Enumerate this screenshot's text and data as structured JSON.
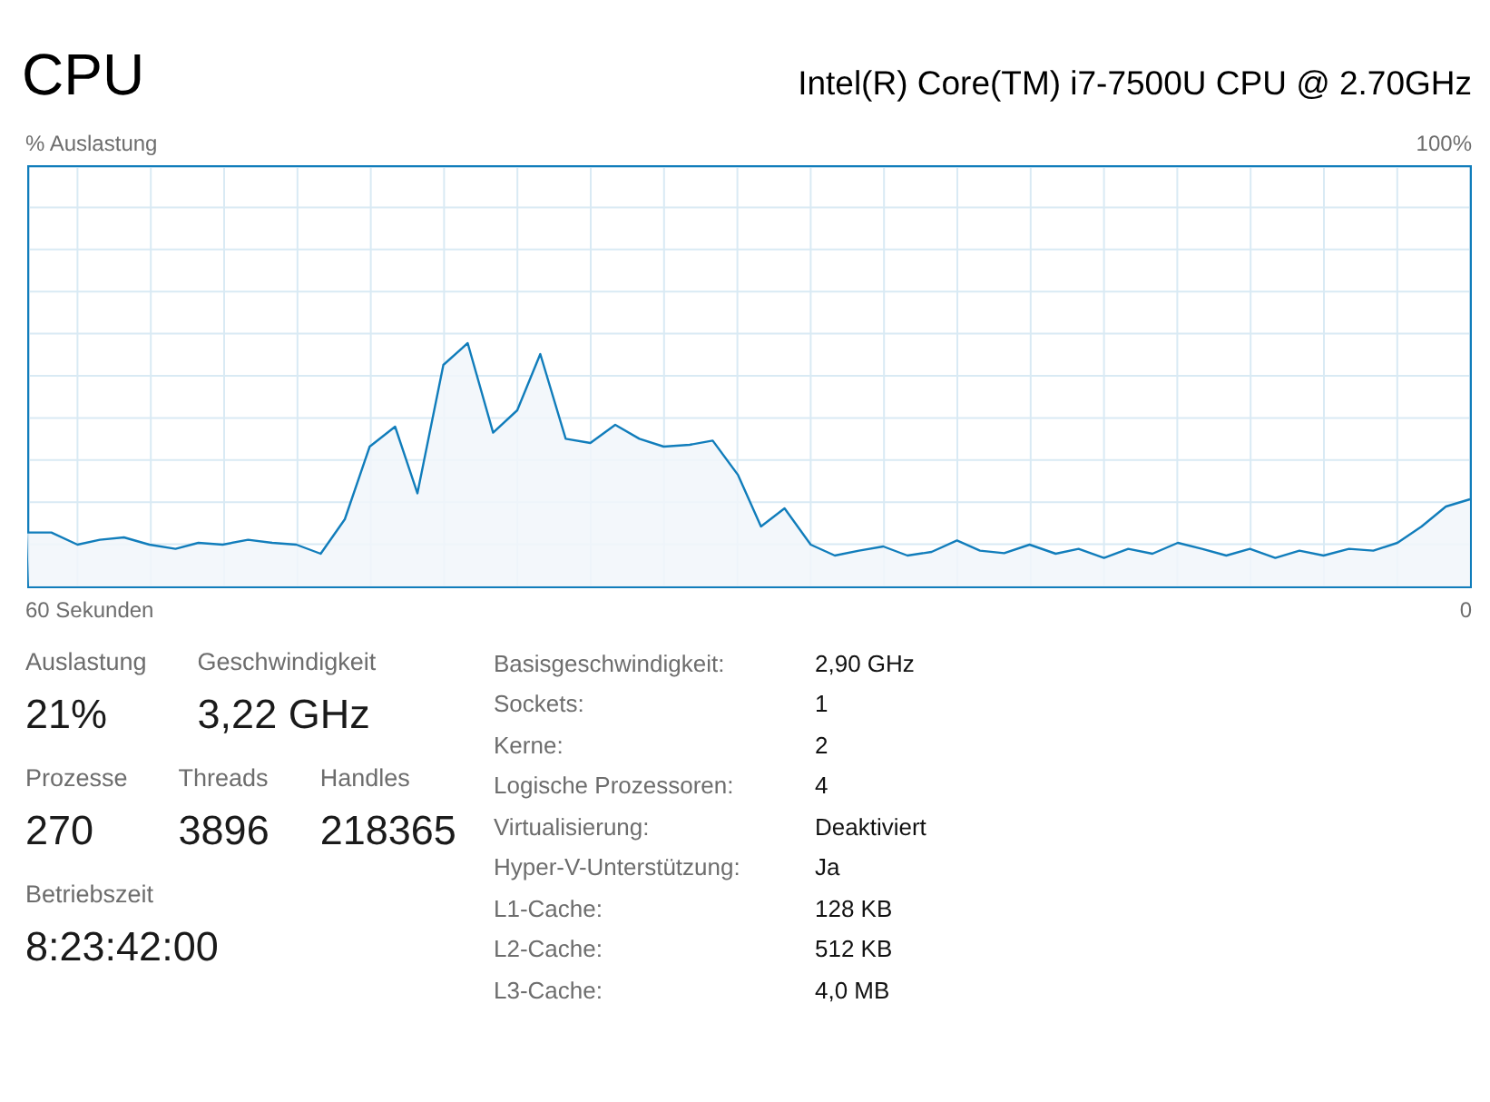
{
  "header": {
    "title": "CPU",
    "processor": "Intel(R) Core(TM) i7-7500U CPU @ 2.70GHz"
  },
  "chart": {
    "y_label": "% Auslastung",
    "y_max_label": "100%",
    "x_start_label": "60 Sekunden",
    "x_end_label": "0"
  },
  "stat_rows": [
    {
      "items": [
        {
          "label": "Auslastung",
          "value": "21%"
        },
        {
          "label": "Geschwindigkeit",
          "value": "3,22 GHz"
        }
      ]
    },
    {
      "items": [
        {
          "label": "Prozesse",
          "value": "270"
        },
        {
          "label": "Threads",
          "value": "3896"
        },
        {
          "label": "Handles",
          "value": "218365"
        }
      ]
    },
    {
      "items": [
        {
          "label": "Betriebszeit",
          "value": "8:23:42:00"
        }
      ]
    }
  ],
  "details": [
    {
      "label": "Basisgeschwindigkeit:",
      "value": "2,90 GHz"
    },
    {
      "label": "Sockets:",
      "value": "1"
    },
    {
      "label": "Kerne:",
      "value": "2"
    },
    {
      "label": "Logische Prozessoren:",
      "value": "4"
    },
    {
      "label": "Virtualisierung:",
      "value": "Deaktiviert"
    },
    {
      "label": "Hyper-V-Unterstützung:",
      "value": "Ja"
    },
    {
      "label": "L1-Cache:",
      "value": "128 KB"
    },
    {
      "label": "L2-Cache:",
      "value": "512 KB"
    },
    {
      "label": "L3-Cache:",
      "value": "4,0 MB"
    }
  ]
}
